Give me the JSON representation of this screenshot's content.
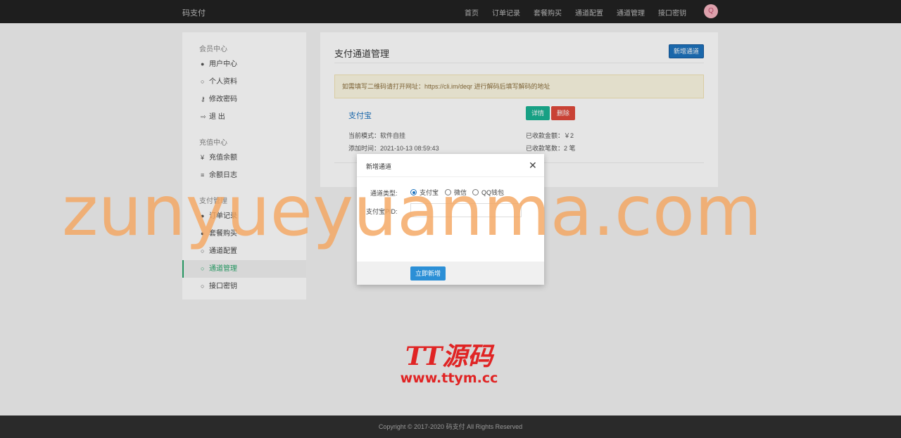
{
  "topnav": {
    "brand": "码支付",
    "links": [
      "首页",
      "订单记录",
      "套餐购买",
      "通道配置",
      "通道管理",
      "接口密钥"
    ],
    "avatar_letter": "Q"
  },
  "sidebar": {
    "groups": [
      {
        "label": "会员中心"
      },
      {
        "label": "充值中心"
      },
      {
        "label": "支付管理"
      }
    ],
    "items": [
      {
        "label": "用户中心",
        "icon": "user-circle-icon"
      },
      {
        "label": "个人资料",
        "icon": "lock-icon"
      },
      {
        "label": "修改密码",
        "icon": "key-icon"
      },
      {
        "label": "退 出",
        "icon": "signout-icon"
      },
      {
        "label": "充值余额",
        "icon": "yen-icon"
      },
      {
        "label": "余额日志",
        "icon": "list-icon"
      },
      {
        "label": "订单记录",
        "icon": "user-circle-icon"
      },
      {
        "label": "套餐购买",
        "icon": "user-circle-icon"
      },
      {
        "label": "通道配置",
        "icon": "lock-icon"
      },
      {
        "label": "通道管理",
        "icon": "lock-icon"
      },
      {
        "label": "接口密钥",
        "icon": "lock-icon"
      }
    ]
  },
  "main": {
    "title": "支付通道管理",
    "new_button": "新增通道",
    "alert": "如需填写二维码请打开网址：https://cli.im/deqr 进行解码后填写解码的地址",
    "channel": {
      "name": "支付宝",
      "detail_button": "详情",
      "delete_button": "删除",
      "mode": "当前模式：软件自挂",
      "added": "添加时间：2021-10-13 08:59:43",
      "amount": "已收款金额：￥2",
      "count": "已收款笔数：2 笔"
    }
  },
  "modal": {
    "title": "新增通道",
    "type_label": "通道类型:",
    "options": [
      "支付宝",
      "微信",
      "QQ钱包"
    ],
    "selected_option": "支付宝",
    "pid_label": "支付宝PID:",
    "pid_value": "",
    "submit": "立即新增"
  },
  "footer": {
    "copyright": "Copyright © 2017-2020 码支付 All Rights Reserved"
  },
  "watermarks": {
    "big": "zunyueyuanma.com",
    "logo_title": "TT源码",
    "logo_url": "www.ttym.cc"
  },
  "colors": {
    "primary": "#1e73be",
    "success": "#1ab394",
    "danger": "#e04a3c",
    "active": "#2aa66b",
    "watermark": "#f4a660",
    "logo": "#e02424"
  }
}
